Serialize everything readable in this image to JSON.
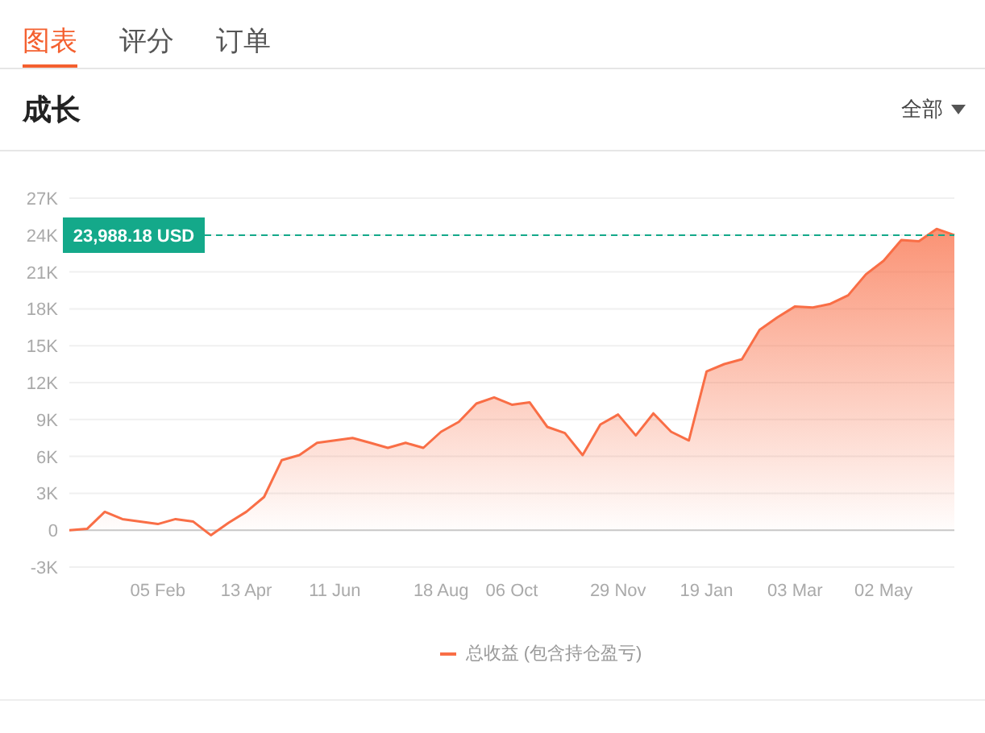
{
  "tabs": [
    {
      "label": "图表",
      "selected": true
    },
    {
      "label": "评分",
      "selected": false
    },
    {
      "label": "订单",
      "selected": false
    }
  ],
  "panel": {
    "title": "成长",
    "filter": {
      "label": "全部"
    },
    "chart_data": {
      "type": "area",
      "categories": [
        null,
        null,
        null,
        null,
        null,
        "05 Feb",
        null,
        null,
        null,
        null,
        "13 Apr",
        null,
        null,
        null,
        null,
        "11 Jun",
        null,
        null,
        null,
        null,
        null,
        "18 Aug",
        null,
        null,
        null,
        "06 Oct",
        null,
        null,
        null,
        null,
        null,
        "29 Nov",
        null,
        null,
        null,
        null,
        "19 Jan",
        null,
        null,
        null,
        null,
        "03 Mar",
        null,
        null,
        null,
        null,
        "02 May",
        null,
        null,
        null,
        null
      ],
      "series": [
        {
          "name": "总收益 (包含持仓盈亏)",
          "color": "#f96e46",
          "values": [
            0,
            100,
            1500,
            900,
            700,
            500,
            900,
            700,
            -400,
            600,
            1500,
            2700,
            5700,
            6100,
            7100,
            7300,
            7500,
            7100,
            6700,
            7100,
            6700,
            8000,
            8800,
            10300,
            10800,
            10200,
            10400,
            8400,
            7900,
            6100,
            8600,
            9400,
            7700,
            9500,
            8000,
            7300,
            12900,
            13500,
            13900,
            16300,
            17300,
            18200,
            18100,
            18400,
            19100,
            20800,
            21900,
            23600,
            23500,
            24500,
            24000
          ]
        }
      ],
      "ylim": [
        -3000,
        27000
      ],
      "yticks": [
        {
          "value": -3000,
          "label": "-3K"
        },
        {
          "value": 0,
          "label": "0"
        },
        {
          "value": 3000,
          "label": "3K"
        },
        {
          "value": 6000,
          "label": "6K"
        },
        {
          "value": 9000,
          "label": "9K"
        },
        {
          "value": 12000,
          "label": "12K"
        },
        {
          "value": 15000,
          "label": "15K"
        },
        {
          "value": 18000,
          "label": "18K"
        },
        {
          "value": 21000,
          "label": "21K"
        },
        {
          "value": 24000,
          "label": "24K"
        },
        {
          "value": 27000,
          "label": "27K"
        }
      ],
      "grid": true,
      "ref_lines": [
        {
          "axis": "y",
          "value": 23988.18,
          "label": "23,988.18 USD"
        }
      ]
    }
  }
}
